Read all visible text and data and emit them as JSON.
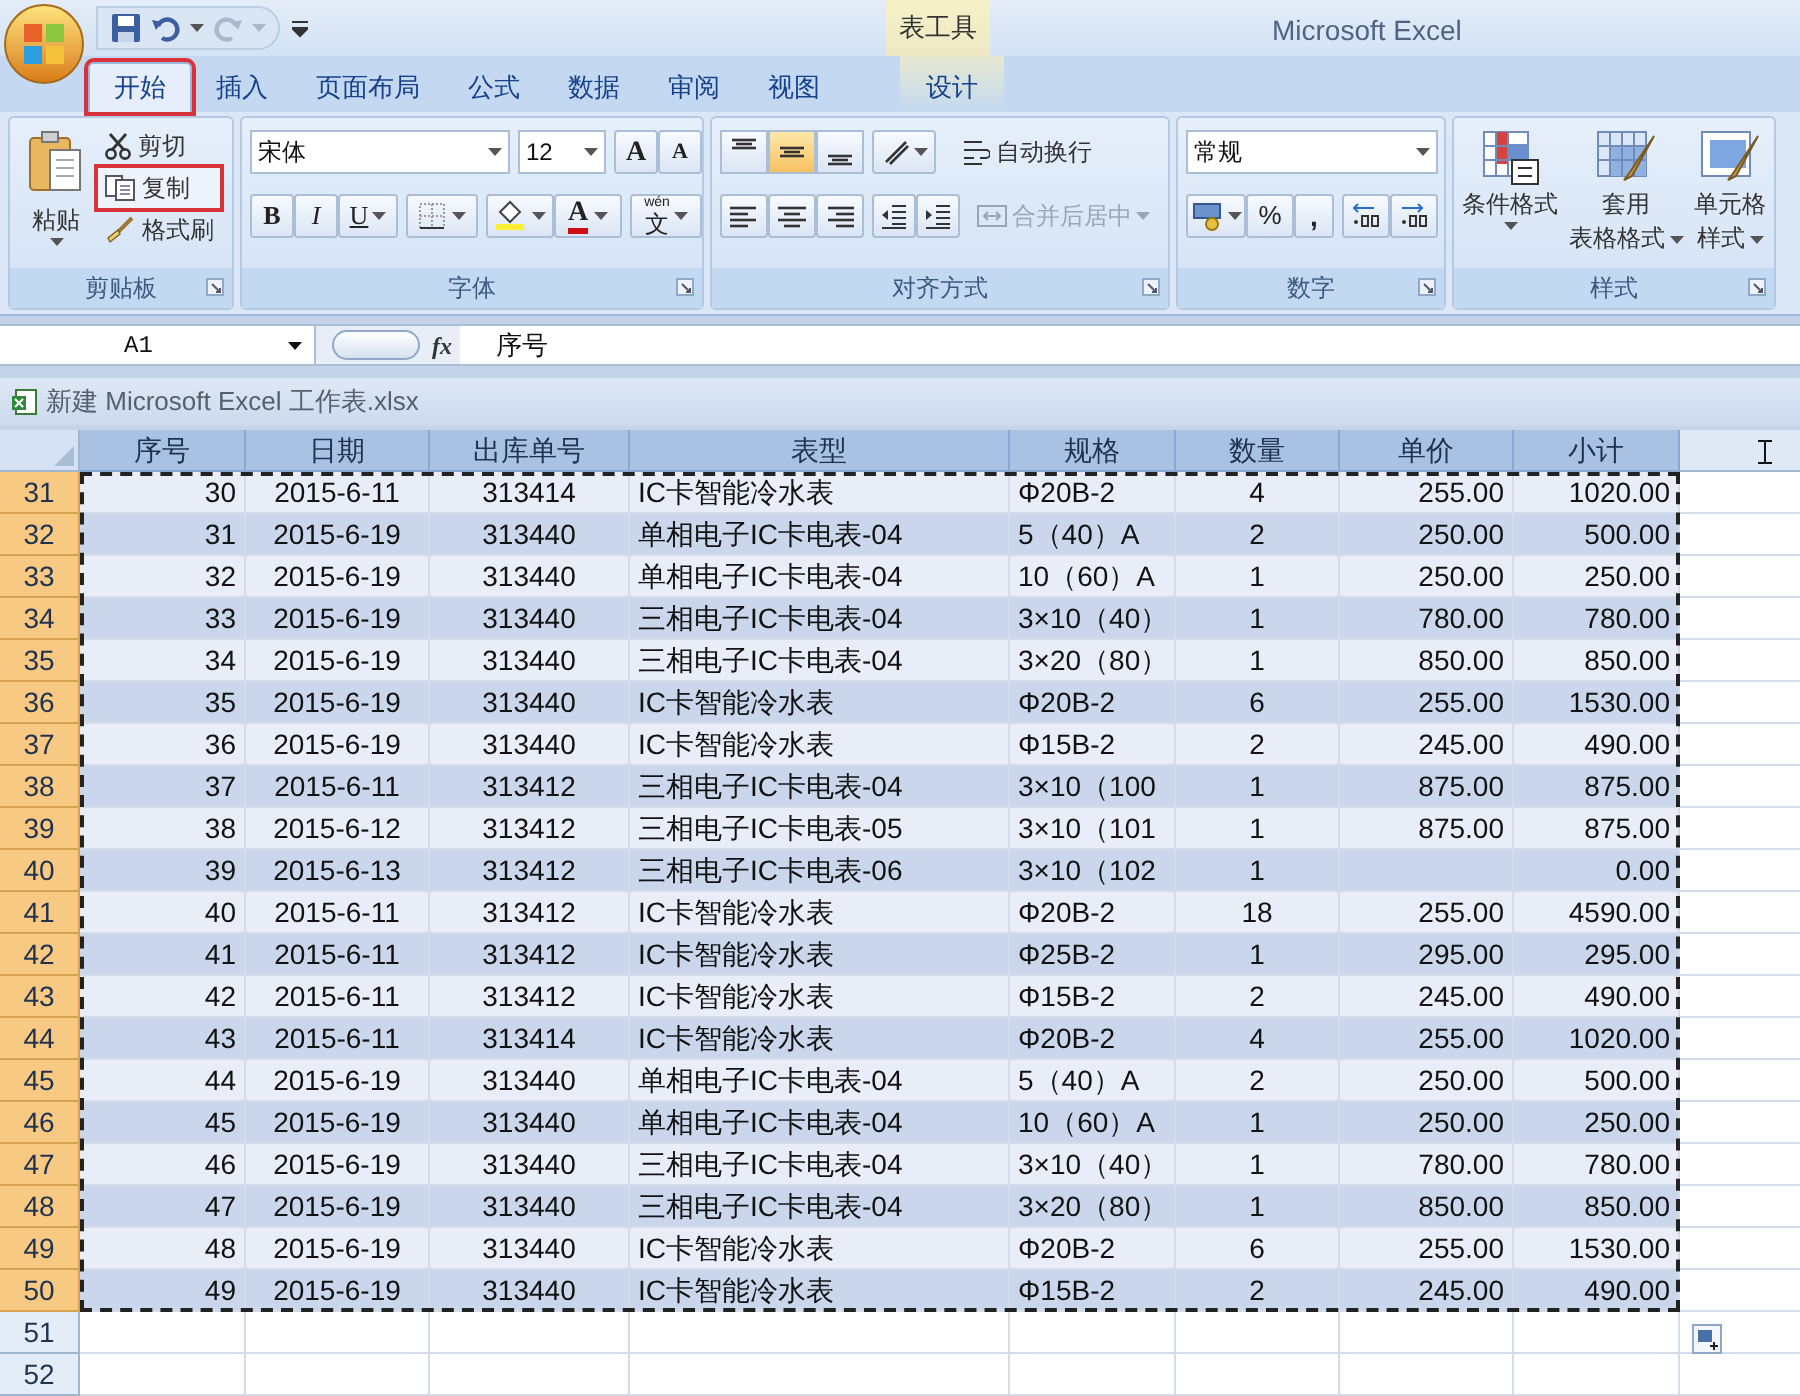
{
  "window": {
    "title": "Microsoft Excel"
  },
  "contextual_tab_group": {
    "label": "表工具"
  },
  "tabs": [
    {
      "label": "开始",
      "selected": true,
      "highlighted": true
    },
    {
      "label": "插入",
      "selected": false,
      "highlighted": false
    },
    {
      "label": "页面布局",
      "selected": false,
      "highlighted": false
    },
    {
      "label": "公式",
      "selected": false,
      "highlighted": false
    },
    {
      "label": "数据",
      "selected": false,
      "highlighted": false
    },
    {
      "label": "审阅",
      "selected": false,
      "highlighted": false
    },
    {
      "label": "视图",
      "selected": false,
      "highlighted": false
    },
    {
      "label": "设计",
      "selected": false,
      "highlighted": false
    }
  ],
  "clipboard": {
    "paste": "粘贴",
    "items": [
      {
        "kind": "cut",
        "label": "剪切",
        "highlighted": false
      },
      {
        "kind": "copy",
        "label": "复制",
        "highlighted": true
      },
      {
        "kind": "painter",
        "label": "格式刷",
        "highlighted": false
      }
    ],
    "group_label": "剪贴板"
  },
  "font": {
    "name": "宋体",
    "size": "12",
    "grow": "A",
    "shrink": "A",
    "bold": "B",
    "italic": "I",
    "underline": "U",
    "font_color": "A",
    "phonetic_top": "wén",
    "phonetic_char": "文",
    "group_label": "字体"
  },
  "alignment": {
    "vertical": [
      {
        "kind": "top",
        "selected": false
      },
      {
        "kind": "middle",
        "selected": true
      },
      {
        "kind": "bottom",
        "selected": false
      }
    ],
    "wrap_text": "自动换行",
    "merge_center": {
      "label": "合并后居中",
      "disabled": true
    },
    "group_label": "对齐方式"
  },
  "number": {
    "format": "常规",
    "percent": "%",
    "comma": ",",
    "group_label": "数字"
  },
  "styles": {
    "items": [
      {
        "kind": "conditional",
        "lines": [
          "条件格式"
        ]
      },
      {
        "kind": "table",
        "lines": [
          "套用",
          "表格格式"
        ]
      },
      {
        "kind": "cell",
        "lines": [
          "单元格",
          "样式"
        ]
      }
    ],
    "group_label": "样式"
  },
  "formula_bar": {
    "name_box": "A1",
    "fx": "fx",
    "value": "序号"
  },
  "workbook": {
    "title": "新建 Microsoft Excel 工作表.xlsx"
  },
  "table": {
    "columns": [
      "序号",
      "日期",
      "出库单号",
      "表型",
      "规格",
      "数量",
      "单价",
      "小计"
    ],
    "rows": [
      {
        "row_number": "31",
        "selected": true,
        "cells": [
          "30",
          "2015-6-11",
          "313414",
          "IC卡智能冷水表",
          "Φ20B-2",
          "4",
          "255.00",
          "1020.00"
        ]
      },
      {
        "row_number": "32",
        "selected": true,
        "cells": [
          "31",
          "2015-6-19",
          "313440",
          "单相电子IC卡电表-04",
          "5（40）A",
          "2",
          "250.00",
          "500.00"
        ]
      },
      {
        "row_number": "33",
        "selected": true,
        "cells": [
          "32",
          "2015-6-19",
          "313440",
          "单相电子IC卡电表-04",
          "10（60）A",
          "1",
          "250.00",
          "250.00"
        ]
      },
      {
        "row_number": "34",
        "selected": true,
        "cells": [
          "33",
          "2015-6-19",
          "313440",
          "三相电子IC卡电表-04",
          "3×10（40）",
          "1",
          "780.00",
          "780.00"
        ]
      },
      {
        "row_number": "35",
        "selected": true,
        "cells": [
          "34",
          "2015-6-19",
          "313440",
          "三相电子IC卡电表-04",
          "3×20（80）",
          "1",
          "850.00",
          "850.00"
        ]
      },
      {
        "row_number": "36",
        "selected": true,
        "cells": [
          "35",
          "2015-6-19",
          "313440",
          "IC卡智能冷水表",
          "Φ20B-2",
          "6",
          "255.00",
          "1530.00"
        ]
      },
      {
        "row_number": "37",
        "selected": true,
        "cells": [
          "36",
          "2015-6-19",
          "313440",
          "IC卡智能冷水表",
          "Φ15B-2",
          "2",
          "245.00",
          "490.00"
        ]
      },
      {
        "row_number": "38",
        "selected": true,
        "cells": [
          "37",
          "2015-6-11",
          "313412",
          "三相电子IC卡电表-04",
          "3×10（100",
          "1",
          "875.00",
          "875.00"
        ]
      },
      {
        "row_number": "39",
        "selected": true,
        "cells": [
          "38",
          "2015-6-12",
          "313412",
          "三相电子IC卡电表-05",
          "3×10（101",
          "1",
          "875.00",
          "875.00"
        ]
      },
      {
        "row_number": "40",
        "selected": true,
        "cells": [
          "39",
          "2015-6-13",
          "313412",
          "三相电子IC卡电表-06",
          "3×10（102",
          "1",
          null,
          "0.00"
        ]
      },
      {
        "row_number": "41",
        "selected": true,
        "cells": [
          "40",
          "2015-6-11",
          "313412",
          "IC卡智能冷水表",
          "Φ20B-2",
          "18",
          "255.00",
          "4590.00"
        ]
      },
      {
        "row_number": "42",
        "selected": true,
        "cells": [
          "41",
          "2015-6-11",
          "313412",
          "IC卡智能冷水表",
          "Φ25B-2",
          "1",
          "295.00",
          "295.00"
        ]
      },
      {
        "row_number": "43",
        "selected": true,
        "cells": [
          "42",
          "2015-6-11",
          "313412",
          "IC卡智能冷水表",
          "Φ15B-2",
          "2",
          "245.00",
          "490.00"
        ]
      },
      {
        "row_number": "44",
        "selected": true,
        "cells": [
          "43",
          "2015-6-11",
          "313414",
          "IC卡智能冷水表",
          "Φ20B-2",
          "4",
          "255.00",
          "1020.00"
        ]
      },
      {
        "row_number": "45",
        "selected": true,
        "cells": [
          "44",
          "2015-6-19",
          "313440",
          "单相电子IC卡电表-04",
          "5（40）A",
          "2",
          "250.00",
          "500.00"
        ]
      },
      {
        "row_number": "46",
        "selected": true,
        "cells": [
          "45",
          "2015-6-19",
          "313440",
          "单相电子IC卡电表-04",
          "10（60）A",
          "1",
          "250.00",
          "250.00"
        ]
      },
      {
        "row_number": "47",
        "selected": true,
        "cells": [
          "46",
          "2015-6-19",
          "313440",
          "三相电子IC卡电表-04",
          "3×10（40）",
          "1",
          "780.00",
          "780.00"
        ]
      },
      {
        "row_number": "48",
        "selected": true,
        "cells": [
          "47",
          "2015-6-19",
          "313440",
          "三相电子IC卡电表-04",
          "3×20（80）",
          "1",
          "850.00",
          "850.00"
        ]
      },
      {
        "row_number": "49",
        "selected": true,
        "cells": [
          "48",
          "2015-6-19",
          "313440",
          "IC卡智能冷水表",
          "Φ20B-2",
          "6",
          "255.00",
          "1530.00"
        ]
      },
      {
        "row_number": "50",
        "selected": true,
        "cells": [
          "49",
          "2015-6-19",
          "313440",
          "IC卡智能冷水表",
          "Φ15B-2",
          "2",
          "245.00",
          "490.00"
        ]
      },
      {
        "row_number": "51",
        "selected": false
      },
      {
        "row_number": "52",
        "selected": false
      }
    ]
  }
}
